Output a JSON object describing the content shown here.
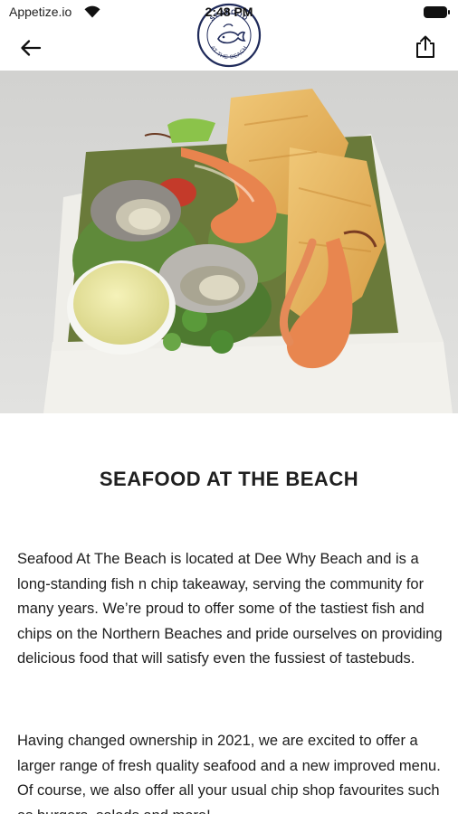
{
  "status_bar": {
    "carrier": "Appetize.io",
    "time": "2:48 PM"
  },
  "nav": {
    "back_icon": "arrow-left-icon",
    "share_icon": "share-icon",
    "logo_text_top": "SEAFOOD",
    "logo_text_bottom": "AT THE BEACH"
  },
  "hero": {
    "image_subject": "fish and chips box with prawns and oysters"
  },
  "content": {
    "title": "SEAFOOD AT THE BEACH",
    "paragraph1": "Seafood At The Beach is located at Dee Why Beach and is a long-standing fish n chip takeaway, serving the community for many years. We’re proud to offer some of the tastiest fish and chips on the Northern Beaches and pride ourselves on providing delicious food that will satisfy even the fussiest of tastebuds.",
    "paragraph2": "Having changed ownership in 2021, we are excited to offer a larger range of fresh quality seafood and a new improved menu. Of course, we also offer all your usual chip shop favourites such as burgers, salads and more!"
  },
  "colors": {
    "logo_navy": "#1f2a5a",
    "text": "#1d1d1d",
    "background": "#ffffff"
  }
}
